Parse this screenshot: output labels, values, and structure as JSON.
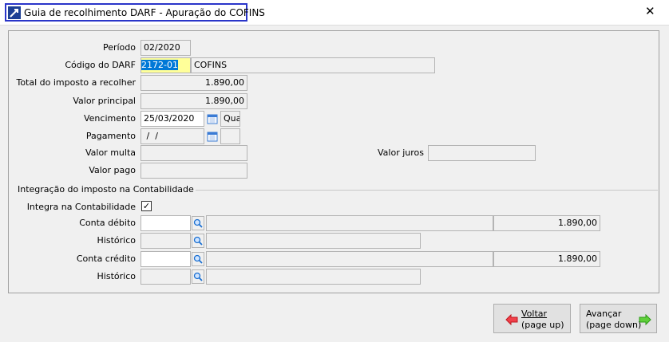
{
  "window": {
    "title": "Guia de recolhimento DARF - Apuração do COFINS",
    "close": "✕"
  },
  "form": {
    "periodo": {
      "label": "Período",
      "value": "02/2020"
    },
    "codigo": {
      "label": "Código do DARF",
      "value": "2172-01",
      "name": "COFINS"
    },
    "total": {
      "label": "Total do imposto a recolher",
      "value": "1.890,00"
    },
    "principal": {
      "label": "Valor principal",
      "value": "1.890,00"
    },
    "vencimento": {
      "label": "Vencimento",
      "value": "25/03/2020",
      "weekday": "Qua"
    },
    "pagamento": {
      "label": "Pagamento",
      "value": " /  /",
      "weekday": ""
    },
    "multa": {
      "label": "Valor multa",
      "value": ""
    },
    "juros": {
      "label": "Valor juros",
      "value": ""
    },
    "pago": {
      "label": "Valor pago",
      "value": ""
    }
  },
  "contabilidade": {
    "group_label": "Integração do imposto na Contabilidade",
    "integra": {
      "label": "Integra na Contabilidade",
      "checked": true
    },
    "debito": {
      "label": "Conta débito",
      "value": "",
      "desc": "",
      "amount": "1.890,00"
    },
    "hist1": {
      "label": "Histórico",
      "value": "",
      "desc": ""
    },
    "credito": {
      "label": "Conta crédito",
      "value": "",
      "desc": "",
      "amount": "1.890,00"
    },
    "hist2": {
      "label": "Histórico",
      "value": "",
      "desc": ""
    }
  },
  "buttons": {
    "voltar": {
      "line1": "Voltar",
      "line2": "(page up)"
    },
    "avancar": {
      "line1": "Avançar",
      "line2": "(page down)"
    }
  },
  "colors": {
    "accent": "#2a35c9",
    "highlight": "#ffff99",
    "selection": "#0078d7"
  }
}
